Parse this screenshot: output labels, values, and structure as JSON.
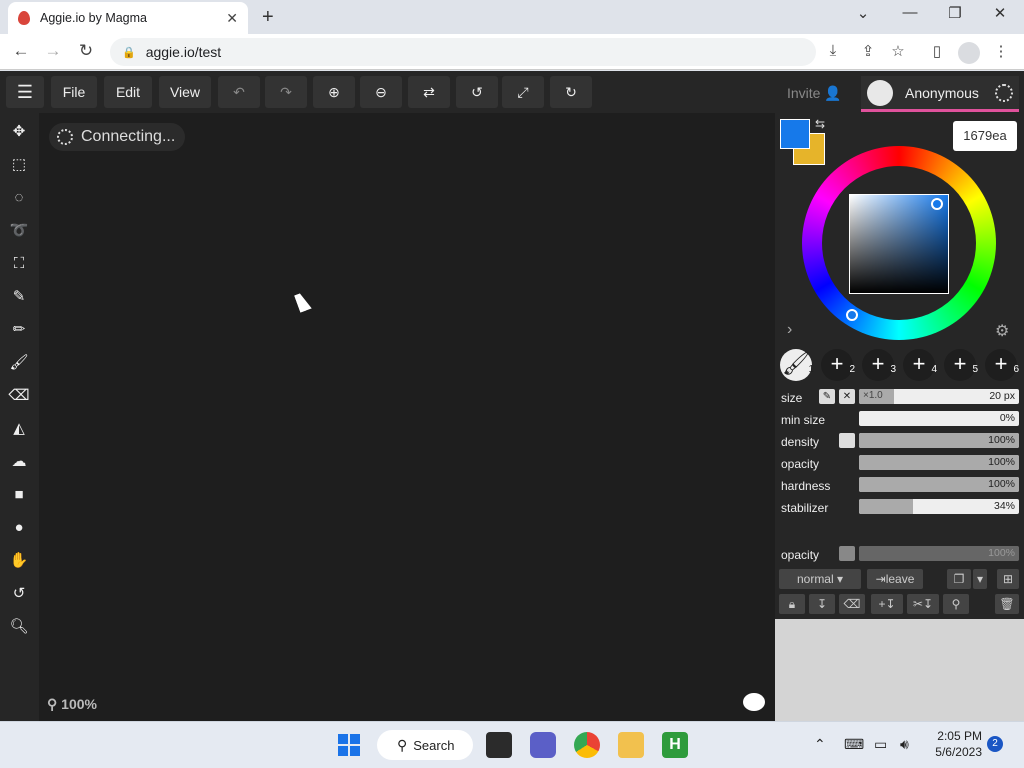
{
  "browser": {
    "tab_title": "Aggie.io by Magma",
    "url": "aggie.io/test"
  },
  "app": {
    "menu": {
      "file": "File",
      "edit": "Edit",
      "view": "View"
    },
    "invite_label": "Invite",
    "user_name": "Anonymous",
    "status": "Connecting...",
    "zoom": "100%",
    "color_hex": "1679ea",
    "primary_color": "#1679ea",
    "secondary_color": "#e6b42a",
    "brush_slots": [
      "1",
      "2",
      "3",
      "4",
      "5",
      "6"
    ],
    "brush_props": {
      "size_label": "size",
      "size_multiplier": "×1.0",
      "size_value": "20 px",
      "min_size_label": "min size",
      "min_size_value": "0%",
      "density_label": "density",
      "density_value": "100%",
      "opacity_label": "opacity",
      "opacity_value": "100%",
      "hardness_label": "hardness",
      "hardness_value": "100%",
      "stabilizer_label": "stabilizer",
      "stabilizer_value": "34%",
      "stabilizer_fraction": 0.34
    },
    "layer": {
      "opacity_label": "opacity",
      "opacity_value": "100%",
      "blend_mode": "normal",
      "leave_label": "leave"
    }
  },
  "taskbar": {
    "search_label": "Search",
    "time": "2:05 PM",
    "date": "5/6/2023",
    "notification_count": "2"
  }
}
